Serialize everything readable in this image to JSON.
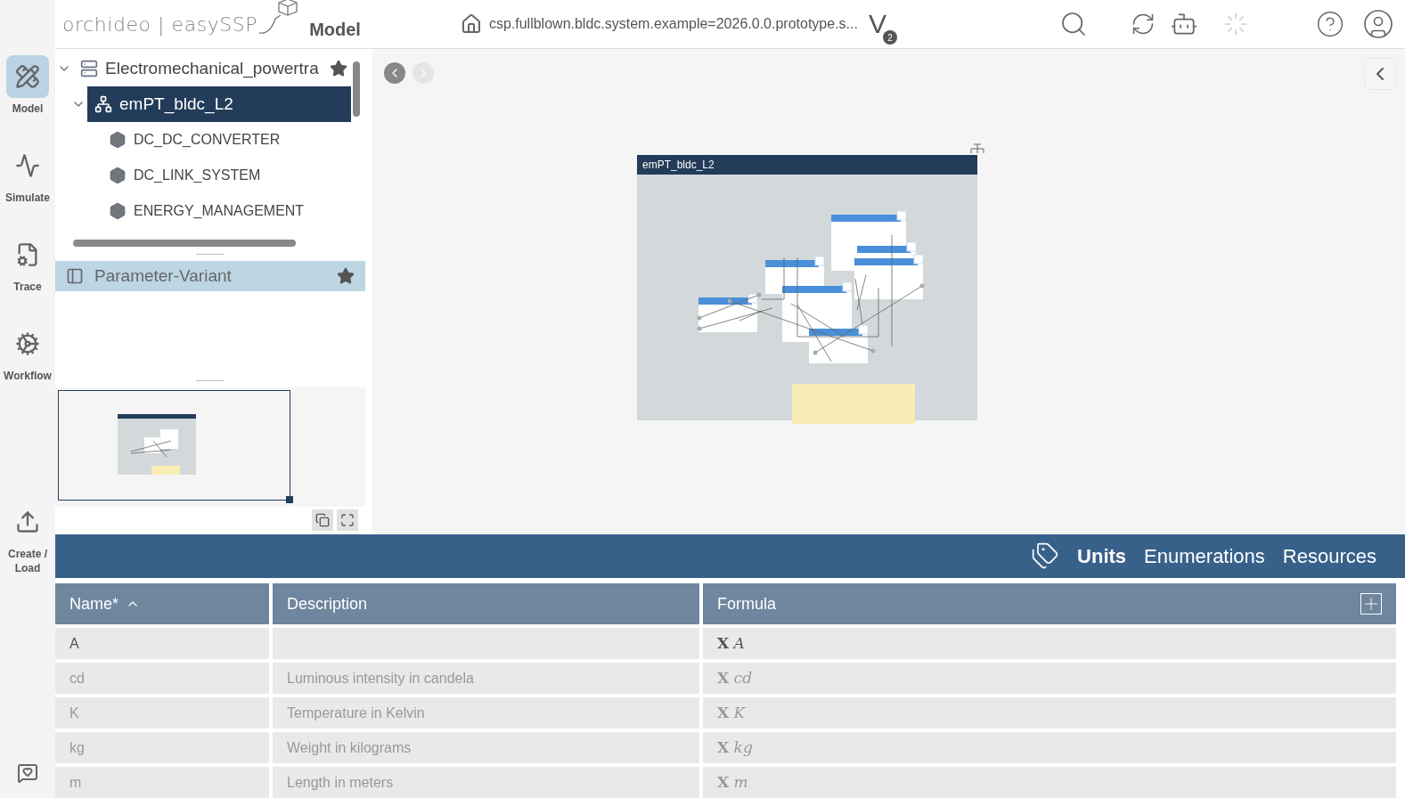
{
  "header": {
    "logo": "orchideo | easySSP",
    "section": "Model",
    "path": "csp.fullblown.bldc.system.example=2026.0.0.prototype.s...",
    "version_letter": "V",
    "version_badge": "2"
  },
  "rail": [
    {
      "label": "Model",
      "selected": true
    },
    {
      "label": "Simulate",
      "selected": false
    },
    {
      "label": "Trace",
      "selected": false
    },
    {
      "label": "Workflow",
      "selected": false
    },
    {
      "label": "Create / Load",
      "selected": false
    }
  ],
  "tree": [
    {
      "label": "Electromechanical_powertra",
      "kind": "ssd",
      "starred": true,
      "expanded": true,
      "selected": false,
      "children": [
        {
          "label": "emPT_bldc_L2",
          "kind": "system",
          "expanded": true,
          "selected": true,
          "children": [
            {
              "label": "DC_DC_CONVERTER",
              "kind": "component",
              "selected": false
            },
            {
              "label": "DC_LINK_SYSTEM",
              "kind": "component",
              "selected": false
            },
            {
              "label": "ENERGY_MANAGEMENT",
              "kind": "component",
              "selected": false
            }
          ]
        }
      ]
    }
  ],
  "variant": {
    "label": "Parameter-Variant",
    "starred": true
  },
  "diagram": {
    "title": "emPT_bldc_L2"
  },
  "tabs": [
    {
      "label": "Units",
      "selected": true
    },
    {
      "label": "Enumerations",
      "selected": false
    },
    {
      "label": "Resources",
      "selected": false
    }
  ],
  "table": {
    "columns": [
      {
        "label": "Name*",
        "sorted": true
      },
      {
        "label": "Description",
        "sorted": false
      },
      {
        "label": "Formula",
        "sorted": false
      }
    ],
    "rows": [
      {
        "name": "A",
        "description": "",
        "formula": "**X** *A*",
        "dimmed": false
      },
      {
        "name": "cd",
        "description": "Luminous intensity in candela",
        "formula": "**X** *cd*",
        "dimmed": true
      },
      {
        "name": "K",
        "description": "Temperature in Kelvin",
        "formula": "**X** *K*",
        "dimmed": true
      },
      {
        "name": "kg",
        "description": "Weight in kilograms",
        "formula": "**X** *kg*",
        "dimmed": true
      },
      {
        "name": "m",
        "description": "Length in meters",
        "formula": "**X** *m*",
        "dimmed": true
      }
    ]
  }
}
